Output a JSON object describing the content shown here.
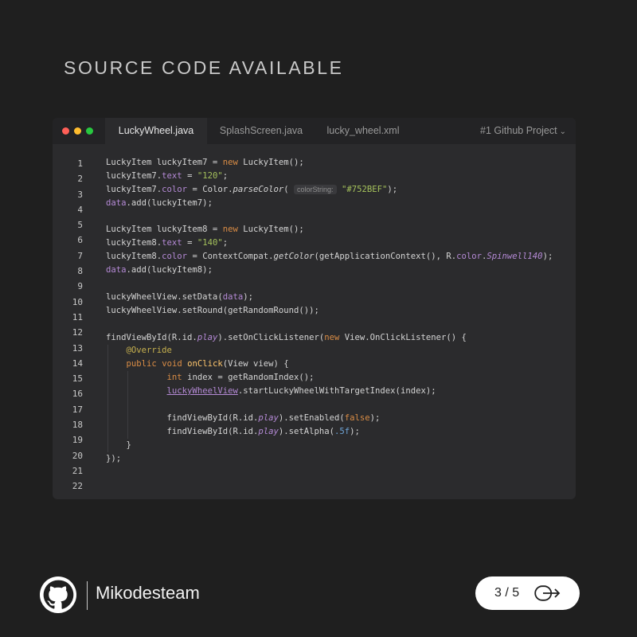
{
  "heading": "SOURCE CODE AVAILABLE",
  "tabs": [
    {
      "label": "LuckyWheel.java",
      "active": true
    },
    {
      "label": "SplashScreen.java",
      "active": false
    },
    {
      "label": "lucky_wheel.xml",
      "active": false
    }
  ],
  "project_menu": "#1 Github Project",
  "line_numbers": [
    "1",
    "2",
    "3",
    "4",
    "5",
    "6",
    "7",
    "8",
    "9",
    "10",
    "11",
    "12",
    "13",
    "14",
    "15",
    "16",
    "17",
    "18",
    "19",
    "20",
    "21",
    "22"
  ],
  "code_lines": [
    "LuckyItem luckyItem7 = new LuckyItem();",
    "luckyItem7.text = \"120\";",
    "luckyItem7.color = Color.parseColor( colorString: \"#752BEF\");",
    "data.add(luckyItem7);",
    "",
    "LuckyItem luckyItem8 = new LuckyItem();",
    "luckyItem8.text = \"140\";",
    "luckyItem8.color = ContextCompat.getColor(getApplicationContext(), R.color.Spinwell140);",
    "data.add(luckyItem8);",
    "",
    "luckyWheelView.setData(data);",
    "luckyWheelView.setRound(getRandomRound());",
    "",
    "findViewById(R.id.play).setOnClickListener(new View.OnClickListener() {",
    "    @Override",
    "    public void onClick(View view) {",
    "            int index = getRandomIndex();",
    "            luckyWheelView.startLuckyWheelWithTargetIndex(index);",
    "",
    "            findViewById(R.id.play).setEnabled(false);",
    "            findViewById(R.id.play).setAlpha(.5f);",
    "    }",
    "});"
  ],
  "brand": "Mikodesteam",
  "pager": "3 / 5",
  "colors": {
    "background": "#1f1f1f",
    "editor": "#2b2b2d",
    "keyword": "#d98c45",
    "string": "#a5c25c",
    "field": "#b58ad6"
  },
  "icons": {
    "brand_logo": "github-icon",
    "pager_next": "arrow-right-icon"
  }
}
